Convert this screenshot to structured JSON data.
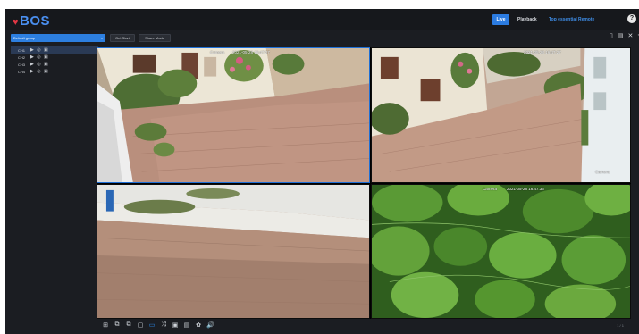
{
  "app": {
    "logo_text": "BOS",
    "logo_heart": "♥"
  },
  "nav": {
    "live": "Live",
    "playback": "Playback",
    "net": "Top essential Remote",
    "help": "?"
  },
  "toolbar": {
    "group_select": "Default group",
    "start_button": "Get Start",
    "stop_button": "Share Mode",
    "right_icons": [
      "▯",
      "▤",
      "✕",
      "◦"
    ]
  },
  "channels": [
    {
      "label": "CH1",
      "icons": "▶ ◎ ▣"
    },
    {
      "label": "CH2",
      "icons": "▶ ◎ ▣"
    },
    {
      "label": "CH3",
      "icons": "▶ ◎ ▣"
    },
    {
      "label": "CH4",
      "icons": "▶ ◎ ▣"
    }
  ],
  "cameras": [
    {
      "name": "Camera",
      "time": "2021-05-28 16:47:27"
    },
    {
      "name": "Camera",
      "time": "2021-05-28 16:47:27"
    },
    {
      "name": "",
      "time": ""
    },
    {
      "name": "Camera",
      "time": "2021-05-28 16:47:36"
    }
  ],
  "bottom_icons": [
    "⊞",
    "⧉",
    "⧉",
    "▢",
    "▭",
    "⤨",
    "▣",
    "▤",
    "✿",
    "🔊"
  ],
  "page_indicator": "1 / 1",
  "colors": {
    "accent": "#2d7fe0",
    "app_bg": "#1b1d22",
    "topbar_bg": "#16181c",
    "selected_border": "#1e6fd6"
  }
}
